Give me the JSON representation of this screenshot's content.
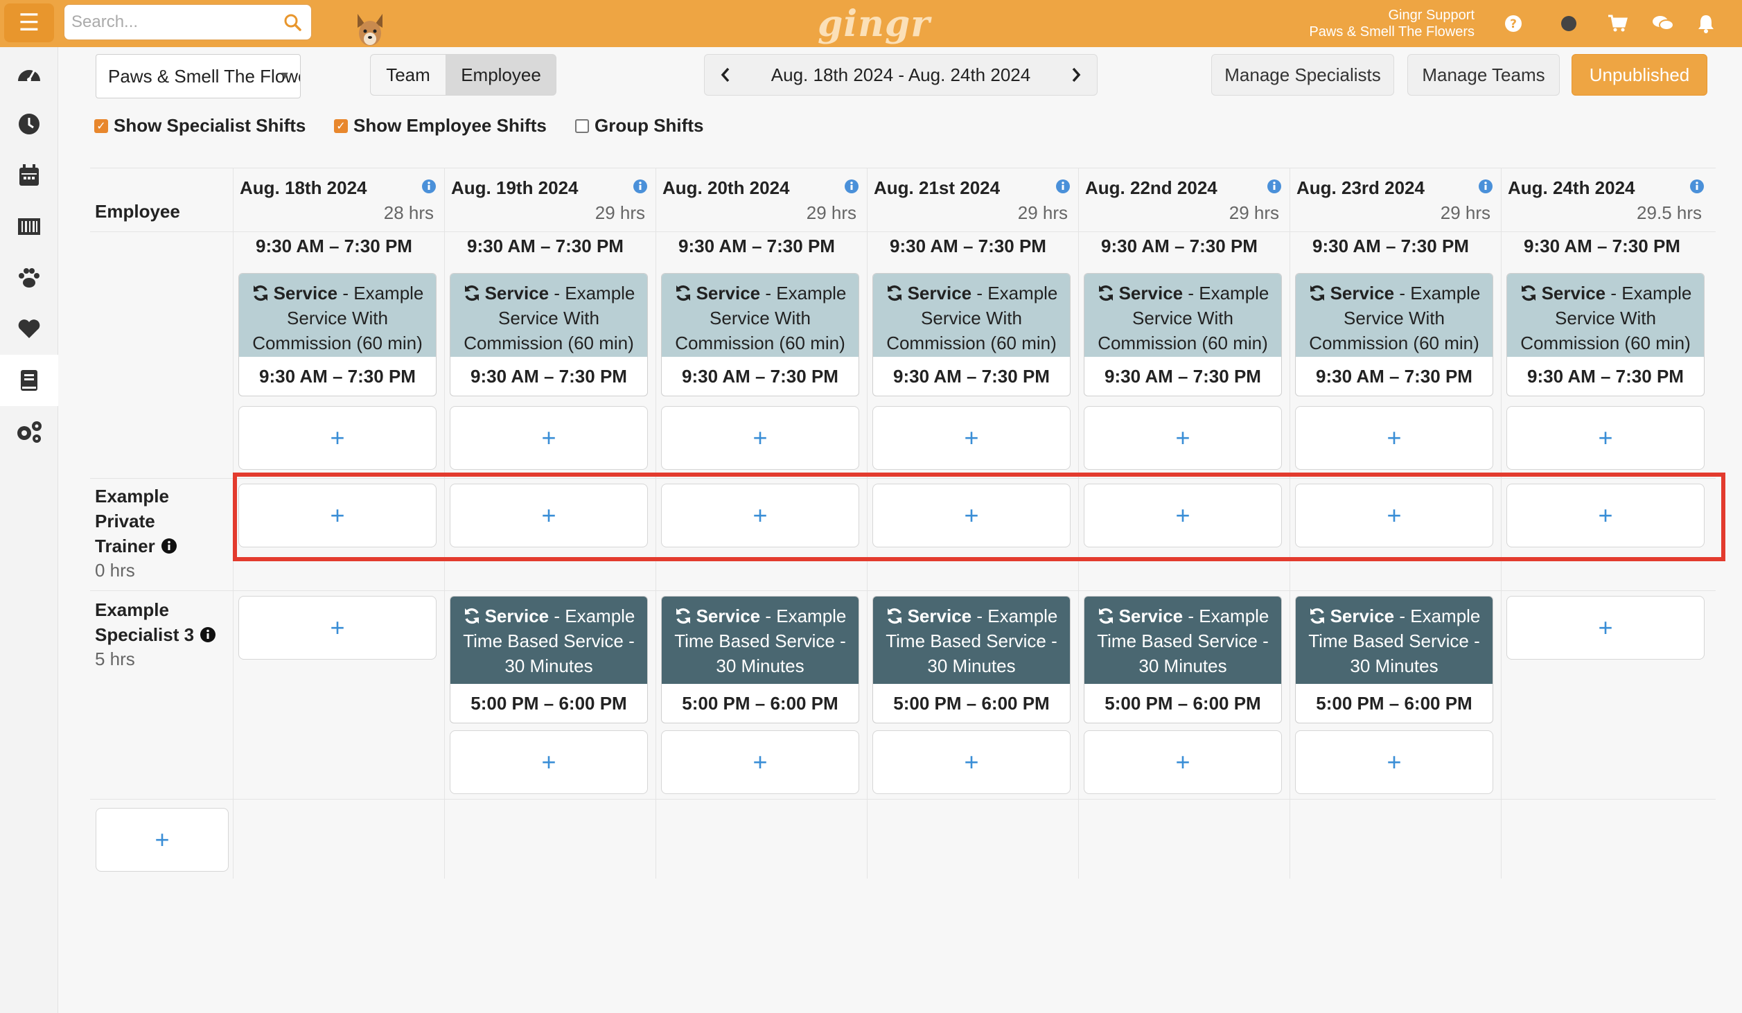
{
  "topbar": {
    "search_placeholder": "Search...",
    "logo": "gingr",
    "user_name": "Gingr Support",
    "user_location": "Paws & Smell The Flowers"
  },
  "toolbar": {
    "location": "Paws & Smell The Flowe...",
    "team_label": "Team",
    "employee_label": "Employee",
    "date_range": "Aug. 18th 2024 - Aug. 24th 2024",
    "manage_specialists": "Manage Specialists",
    "manage_teams": "Manage Teams",
    "unpublished": "Unpublished"
  },
  "filters": {
    "show_specialist_shifts": "Show Specialist Shifts",
    "show_employee_shifts": "Show Employee Shifts",
    "group_shifts": "Group Shifts"
  },
  "grid": {
    "employee_header": "Employee",
    "days": [
      {
        "date": "Aug. 18th 2024",
        "hrs": "28 hrs"
      },
      {
        "date": "Aug. 19th 2024",
        "hrs": "29 hrs"
      },
      {
        "date": "Aug. 20th 2024",
        "hrs": "29 hrs"
      },
      {
        "date": "Aug. 21st 2024",
        "hrs": "29 hrs"
      },
      {
        "date": "Aug. 22nd 2024",
        "hrs": "29 hrs"
      },
      {
        "date": "Aug. 23rd 2024",
        "hrs": "29 hrs"
      },
      {
        "date": "Aug. 24th 2024",
        "hrs": "29.5 hrs"
      }
    ],
    "shift_time": "9:30 AM – 7:30 PM",
    "service_prefix": "Service",
    "commission_service": "- Example Service With Commission (60 min)",
    "commission_line1": " - Example",
    "commission_line2": "Service With",
    "commission_line3": "Commission (60 min)",
    "rows": [
      {
        "name_line1": "Example",
        "name_line2": "Private",
        "name_line3": "Trainer",
        "hrs": "0 hrs"
      },
      {
        "name_line1": "Example",
        "name_line2": "Specialist 3",
        "hrs": "5 hrs"
      }
    ],
    "time_based_line1": " - Example",
    "time_based_line2": "Time Based Service -",
    "time_based_line3": "30 Minutes",
    "time_based_time": "5:00 PM – 6:00 PM",
    "plus": "+"
  }
}
